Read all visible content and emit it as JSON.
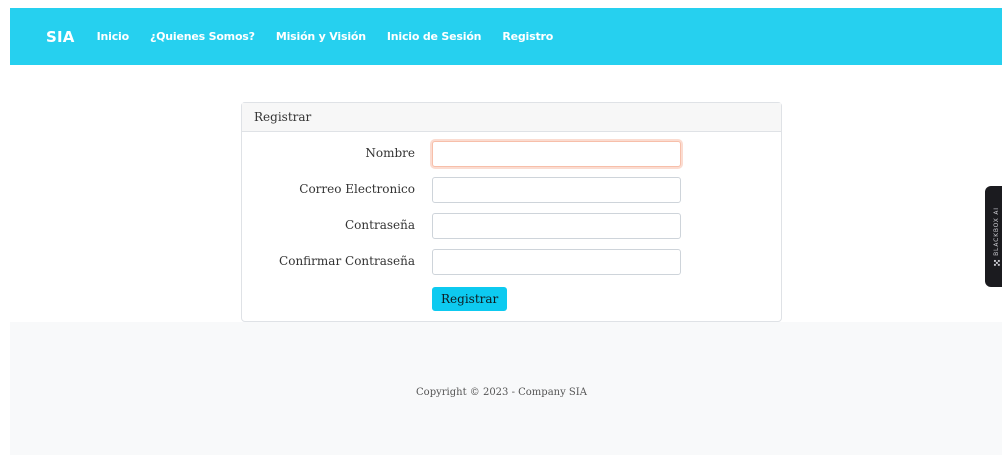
{
  "navbar": {
    "brand": "SIA",
    "links": [
      "Inicio",
      "¿Quienes Somos?",
      "Misión y Visión",
      "Inicio de Sesión",
      "Registro"
    ]
  },
  "form": {
    "header": "Registrar",
    "fields": [
      {
        "label": "Nombre",
        "value": "",
        "placeholder": ""
      },
      {
        "label": "Correo Electronico",
        "value": "",
        "placeholder": ""
      },
      {
        "label": "Contraseña",
        "value": "",
        "placeholder": ""
      },
      {
        "label": "Confirmar Contraseña",
        "value": "",
        "placeholder": ""
      }
    ],
    "submit_label": "Registrar"
  },
  "footer": {
    "copyright": "Copyright © 2023 - Company SIA"
  },
  "side_tab": {
    "label": "BLACKBOX AI",
    "icon": "blackbox-logo-icon"
  },
  "colors": {
    "navbar_bg": "#26d0ef",
    "button_bg": "#0dcaf0",
    "footer_bg": "#f8f9fa",
    "focus_ring": "#f7bfaa"
  }
}
